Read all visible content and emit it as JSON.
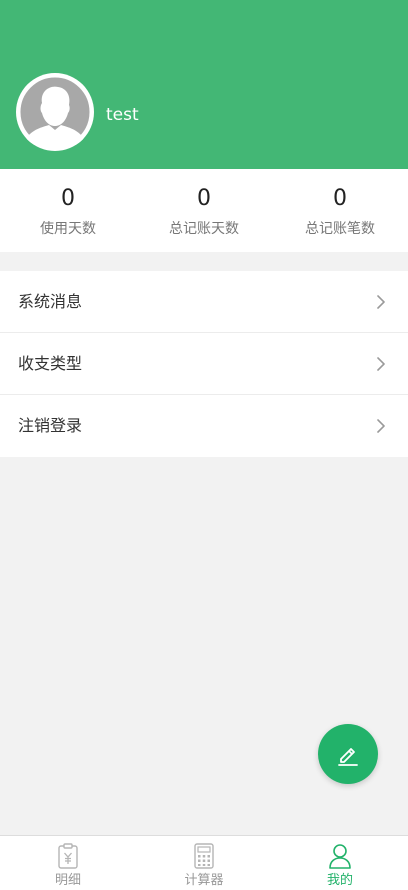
{
  "profile": {
    "username": "test"
  },
  "stats": [
    {
      "value": "0",
      "label": "使用天数"
    },
    {
      "value": "0",
      "label": "总记账天数"
    },
    {
      "value": "0",
      "label": "总记账笔数"
    }
  ],
  "menu": [
    {
      "label": "系统消息",
      "icon": "chevron-right-icon"
    },
    {
      "label": "收支类型",
      "icon": "chevron-right-icon"
    },
    {
      "label": "注销登录",
      "icon": "chevron-right-icon"
    }
  ],
  "fab": {
    "icon": "edit-pencil-icon"
  },
  "tabbar": [
    {
      "label": "明细",
      "icon": "bill-yuan-icon",
      "active": false
    },
    {
      "label": "计算器",
      "icon": "calculator-icon",
      "active": false
    },
    {
      "label": "我的",
      "icon": "user-icon",
      "active": true
    }
  ],
  "colors": {
    "header": "#43b775",
    "accent": "#22b26a",
    "background": "#f2f2f2"
  }
}
